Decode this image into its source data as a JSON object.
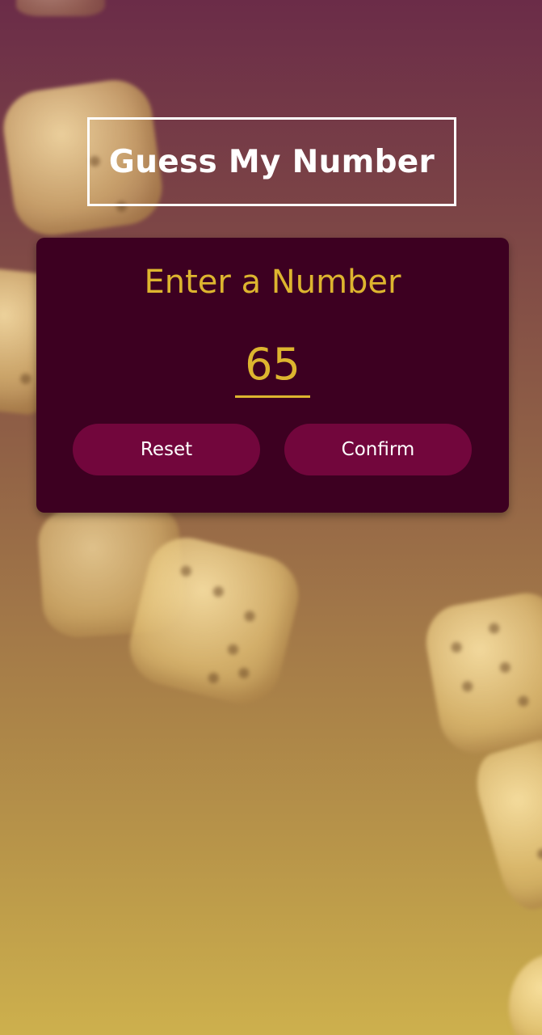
{
  "header": {
    "title": "Guess My Number"
  },
  "card": {
    "label": "Enter a Number",
    "input_value": "65",
    "reset_label": "Reset",
    "confirm_label": "Confirm"
  },
  "colors": {
    "accent": "#ddb52f",
    "card_background": "#3d0021",
    "button_background": "#72063c",
    "gradient_top": "#6b2c48",
    "gradient_bottom": "#cdb04d"
  },
  "background": {
    "image": "blurred-dice"
  }
}
